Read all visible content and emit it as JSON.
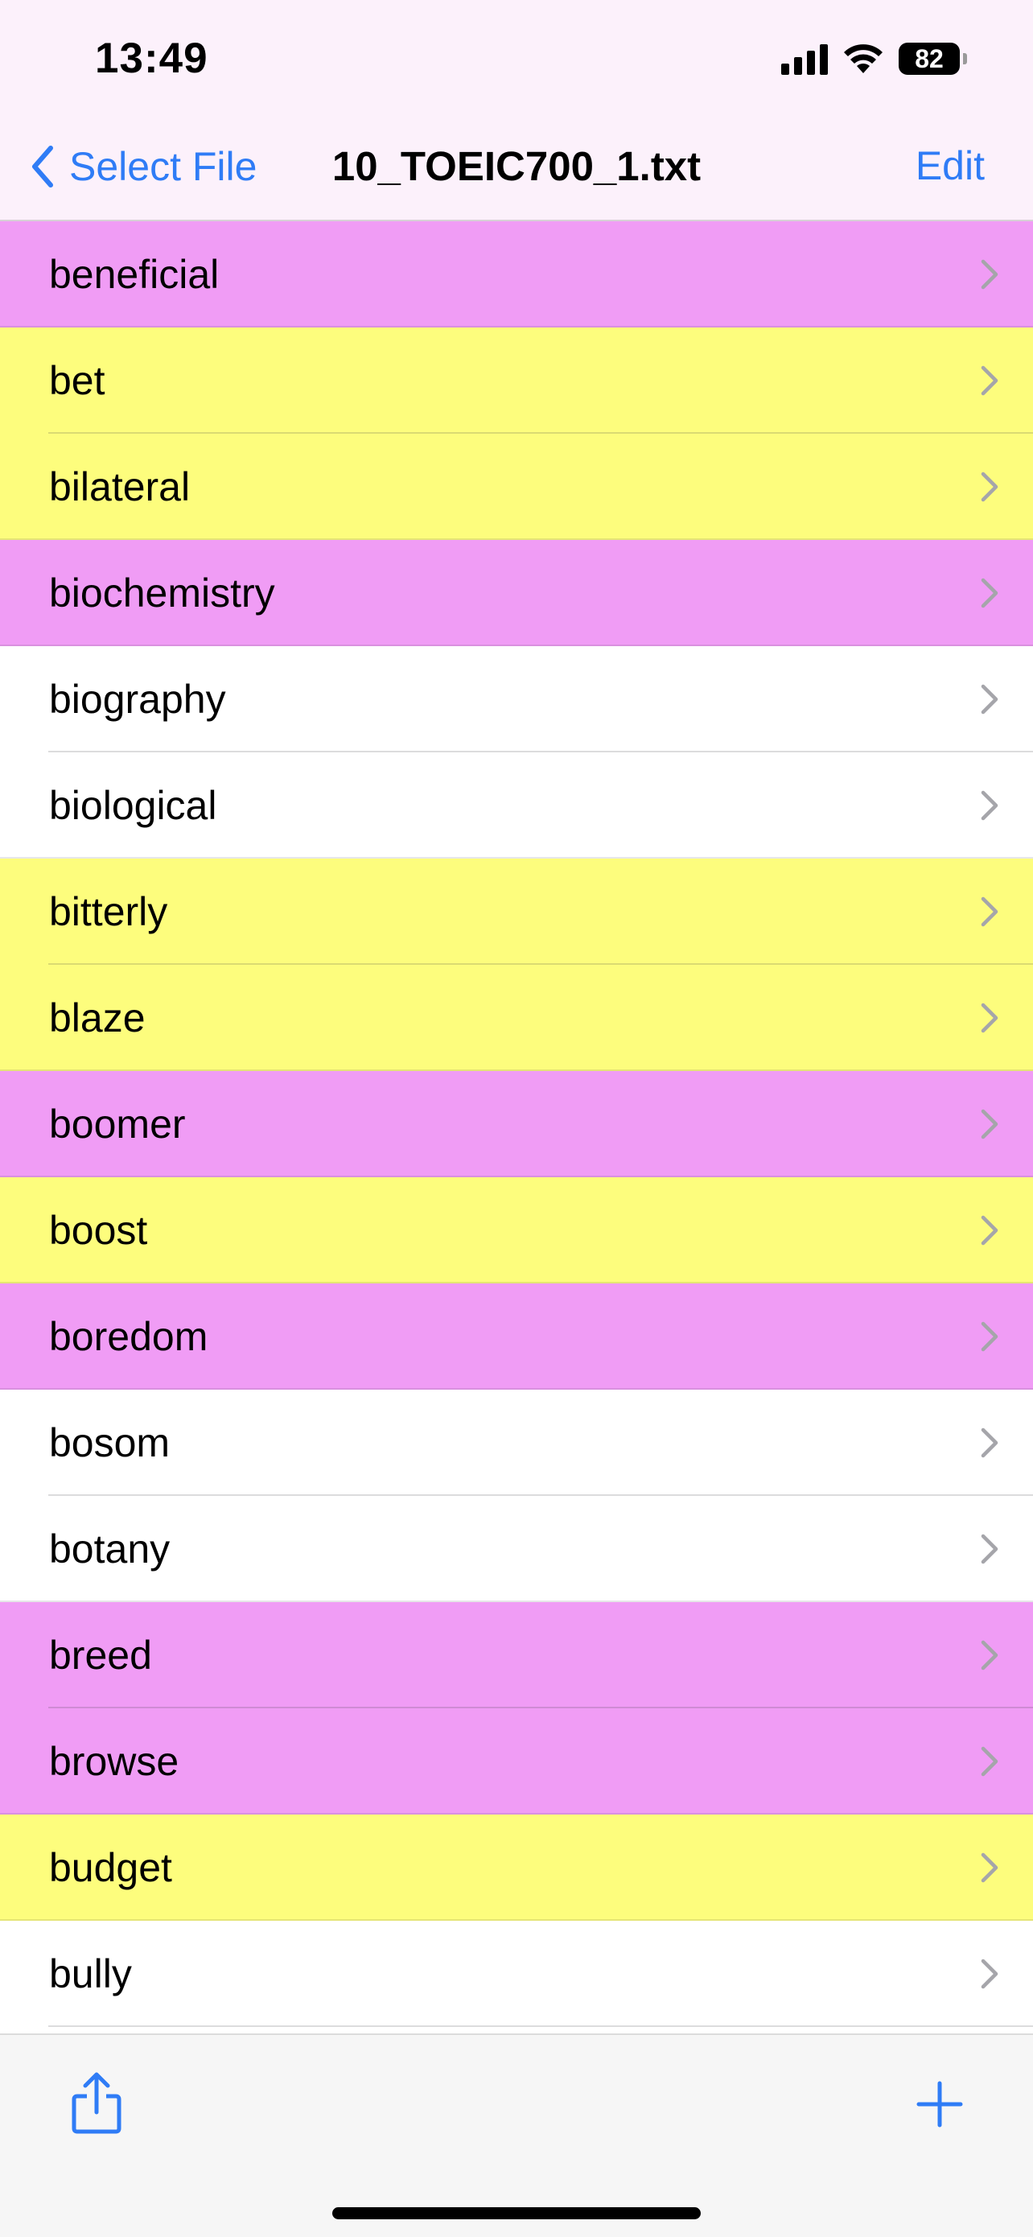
{
  "status_bar": {
    "time": "13:49",
    "battery_level": "82",
    "icons": [
      "cellular-signal-icon",
      "wifi-icon",
      "battery-icon"
    ]
  },
  "nav": {
    "back_label": "Select File",
    "title": "10_TOEIC700_1.txt",
    "edit_label": "Edit"
  },
  "colors": {
    "accent": "#2f7cf6",
    "highlight_yellow": "#fdfd7d",
    "highlight_pink": "#f09cf5",
    "row_default": "#ffffff"
  },
  "words": [
    {
      "label": "beneficial",
      "highlight": "pink"
    },
    {
      "label": "bet",
      "highlight": "yellow"
    },
    {
      "label": "bilateral",
      "highlight": "yellow"
    },
    {
      "label": "biochemistry",
      "highlight": "pink"
    },
    {
      "label": "biography",
      "highlight": "white"
    },
    {
      "label": "biological",
      "highlight": "white"
    },
    {
      "label": "bitterly",
      "highlight": "yellow"
    },
    {
      "label": "blaze",
      "highlight": "yellow"
    },
    {
      "label": "boomer",
      "highlight": "pink"
    },
    {
      "label": "boost",
      "highlight": "yellow"
    },
    {
      "label": "boredom",
      "highlight": "pink"
    },
    {
      "label": "bosom",
      "highlight": "white"
    },
    {
      "label": "botany",
      "highlight": "white"
    },
    {
      "label": "breed",
      "highlight": "pink"
    },
    {
      "label": "browse",
      "highlight": "pink"
    },
    {
      "label": "budget",
      "highlight": "yellow"
    },
    {
      "label": "bully",
      "highlight": "white"
    }
  ],
  "toolbar": {
    "icons": [
      "share-icon",
      "plus-icon"
    ]
  }
}
